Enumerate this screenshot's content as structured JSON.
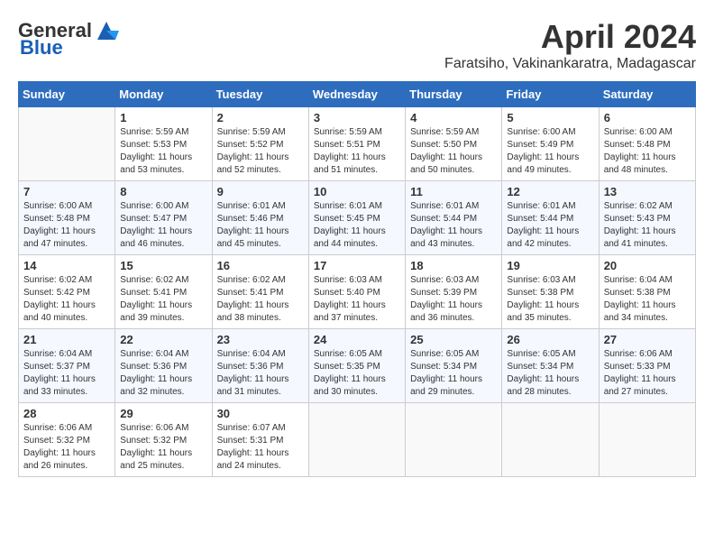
{
  "header": {
    "logo_general": "General",
    "logo_blue": "Blue",
    "title": "April 2024",
    "subtitle": "Faratsiho, Vakinankaratra, Madagascar"
  },
  "calendar": {
    "days_of_week": [
      "Sunday",
      "Monday",
      "Tuesday",
      "Wednesday",
      "Thursday",
      "Friday",
      "Saturday"
    ],
    "weeks": [
      [
        {
          "day": "",
          "info": ""
        },
        {
          "day": "1",
          "info": "Sunrise: 5:59 AM\nSunset: 5:53 PM\nDaylight: 11 hours\nand 53 minutes."
        },
        {
          "day": "2",
          "info": "Sunrise: 5:59 AM\nSunset: 5:52 PM\nDaylight: 11 hours\nand 52 minutes."
        },
        {
          "day": "3",
          "info": "Sunrise: 5:59 AM\nSunset: 5:51 PM\nDaylight: 11 hours\nand 51 minutes."
        },
        {
          "day": "4",
          "info": "Sunrise: 5:59 AM\nSunset: 5:50 PM\nDaylight: 11 hours\nand 50 minutes."
        },
        {
          "day": "5",
          "info": "Sunrise: 6:00 AM\nSunset: 5:49 PM\nDaylight: 11 hours\nand 49 minutes."
        },
        {
          "day": "6",
          "info": "Sunrise: 6:00 AM\nSunset: 5:48 PM\nDaylight: 11 hours\nand 48 minutes."
        }
      ],
      [
        {
          "day": "7",
          "info": "Sunrise: 6:00 AM\nSunset: 5:48 PM\nDaylight: 11 hours\nand 47 minutes."
        },
        {
          "day": "8",
          "info": "Sunrise: 6:00 AM\nSunset: 5:47 PM\nDaylight: 11 hours\nand 46 minutes."
        },
        {
          "day": "9",
          "info": "Sunrise: 6:01 AM\nSunset: 5:46 PM\nDaylight: 11 hours\nand 45 minutes."
        },
        {
          "day": "10",
          "info": "Sunrise: 6:01 AM\nSunset: 5:45 PM\nDaylight: 11 hours\nand 44 minutes."
        },
        {
          "day": "11",
          "info": "Sunrise: 6:01 AM\nSunset: 5:44 PM\nDaylight: 11 hours\nand 43 minutes."
        },
        {
          "day": "12",
          "info": "Sunrise: 6:01 AM\nSunset: 5:44 PM\nDaylight: 11 hours\nand 42 minutes."
        },
        {
          "day": "13",
          "info": "Sunrise: 6:02 AM\nSunset: 5:43 PM\nDaylight: 11 hours\nand 41 minutes."
        }
      ],
      [
        {
          "day": "14",
          "info": "Sunrise: 6:02 AM\nSunset: 5:42 PM\nDaylight: 11 hours\nand 40 minutes."
        },
        {
          "day": "15",
          "info": "Sunrise: 6:02 AM\nSunset: 5:41 PM\nDaylight: 11 hours\nand 39 minutes."
        },
        {
          "day": "16",
          "info": "Sunrise: 6:02 AM\nSunset: 5:41 PM\nDaylight: 11 hours\nand 38 minutes."
        },
        {
          "day": "17",
          "info": "Sunrise: 6:03 AM\nSunset: 5:40 PM\nDaylight: 11 hours\nand 37 minutes."
        },
        {
          "day": "18",
          "info": "Sunrise: 6:03 AM\nSunset: 5:39 PM\nDaylight: 11 hours\nand 36 minutes."
        },
        {
          "day": "19",
          "info": "Sunrise: 6:03 AM\nSunset: 5:38 PM\nDaylight: 11 hours\nand 35 minutes."
        },
        {
          "day": "20",
          "info": "Sunrise: 6:04 AM\nSunset: 5:38 PM\nDaylight: 11 hours\nand 34 minutes."
        }
      ],
      [
        {
          "day": "21",
          "info": "Sunrise: 6:04 AM\nSunset: 5:37 PM\nDaylight: 11 hours\nand 33 minutes."
        },
        {
          "day": "22",
          "info": "Sunrise: 6:04 AM\nSunset: 5:36 PM\nDaylight: 11 hours\nand 32 minutes."
        },
        {
          "day": "23",
          "info": "Sunrise: 6:04 AM\nSunset: 5:36 PM\nDaylight: 11 hours\nand 31 minutes."
        },
        {
          "day": "24",
          "info": "Sunrise: 6:05 AM\nSunset: 5:35 PM\nDaylight: 11 hours\nand 30 minutes."
        },
        {
          "day": "25",
          "info": "Sunrise: 6:05 AM\nSunset: 5:34 PM\nDaylight: 11 hours\nand 29 minutes."
        },
        {
          "day": "26",
          "info": "Sunrise: 6:05 AM\nSunset: 5:34 PM\nDaylight: 11 hours\nand 28 minutes."
        },
        {
          "day": "27",
          "info": "Sunrise: 6:06 AM\nSunset: 5:33 PM\nDaylight: 11 hours\nand 27 minutes."
        }
      ],
      [
        {
          "day": "28",
          "info": "Sunrise: 6:06 AM\nSunset: 5:32 PM\nDaylight: 11 hours\nand 26 minutes."
        },
        {
          "day": "29",
          "info": "Sunrise: 6:06 AM\nSunset: 5:32 PM\nDaylight: 11 hours\nand 25 minutes."
        },
        {
          "day": "30",
          "info": "Sunrise: 6:07 AM\nSunset: 5:31 PM\nDaylight: 11 hours\nand 24 minutes."
        },
        {
          "day": "",
          "info": ""
        },
        {
          "day": "",
          "info": ""
        },
        {
          "day": "",
          "info": ""
        },
        {
          "day": "",
          "info": ""
        }
      ]
    ]
  }
}
